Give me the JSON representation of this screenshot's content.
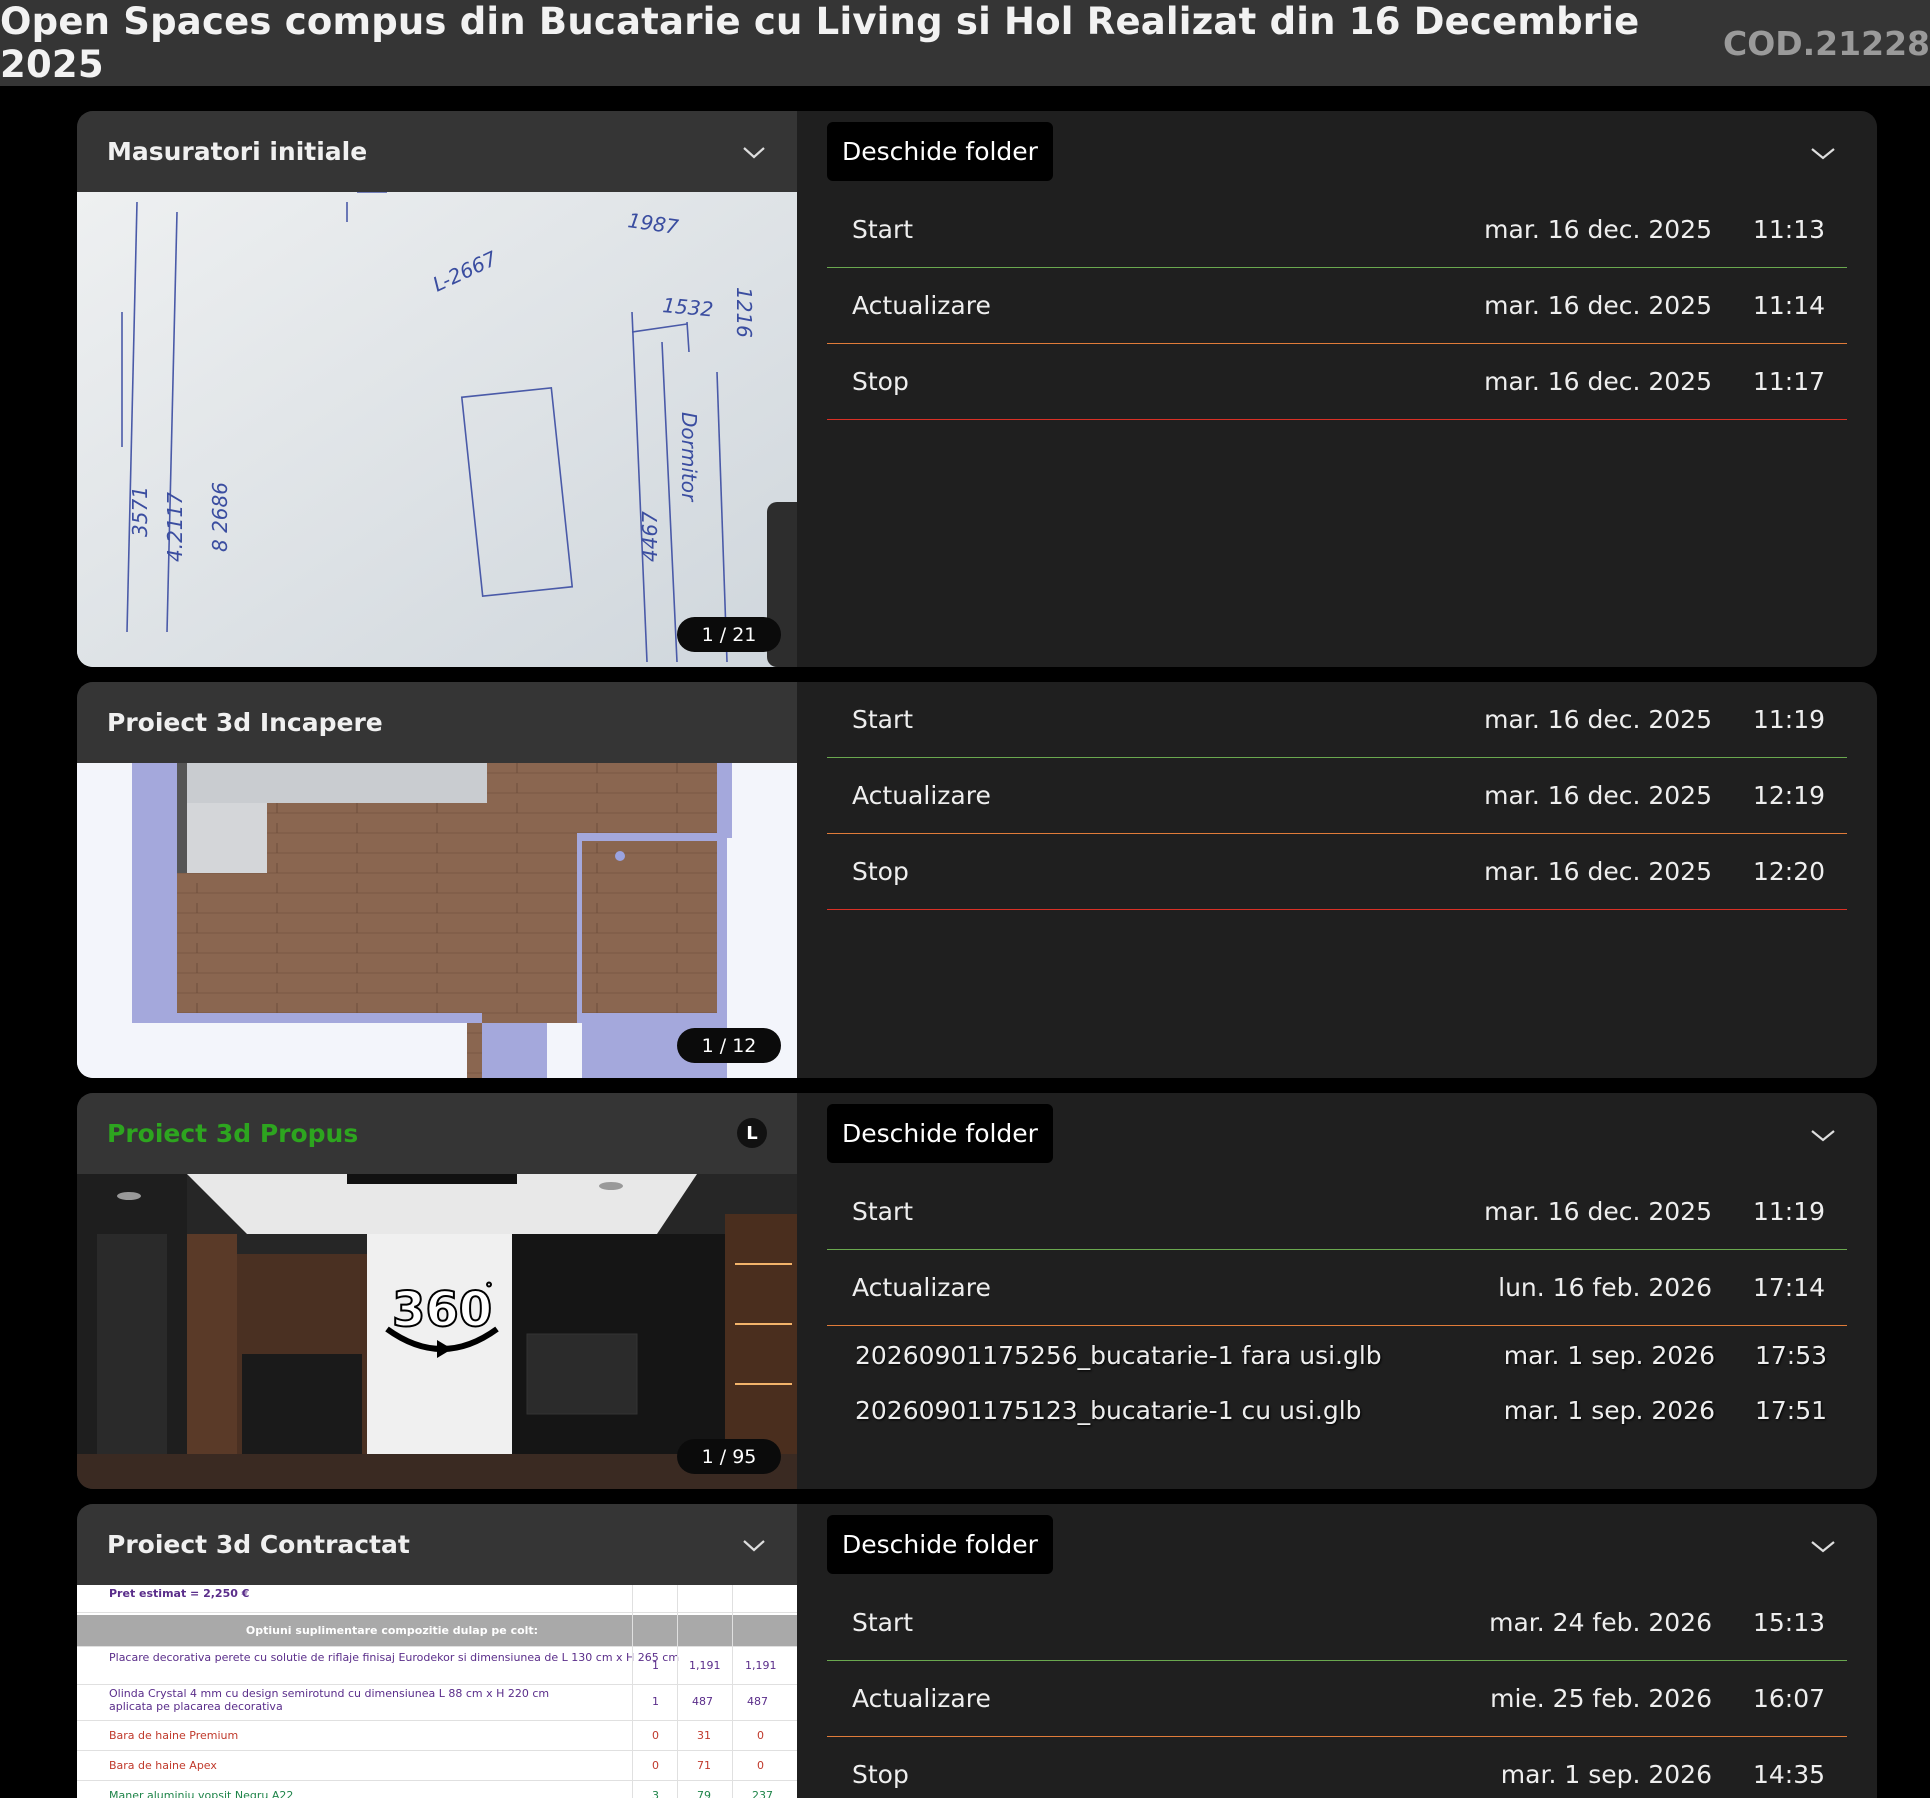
{
  "header": {
    "title": "Open Spaces compus din Bucatarie cu Living si Hol Realizat din 16 Decembrie 2025",
    "code": "COD.21228"
  },
  "sections": [
    {
      "title": "Masuratori initiale",
      "counter": "1  /  21",
      "folder_button": "Deschide folder",
      "rows": [
        {
          "label": "Start",
          "date": "mar. 16 dec. 2025",
          "time": "11:13"
        },
        {
          "label": "Actualizare",
          "date": "mar. 16 dec. 2025",
          "time": "11:14"
        },
        {
          "label": "Stop",
          "date": "mar. 16 dec. 2025",
          "time": "11:17"
        }
      ]
    },
    {
      "title": "Proiect 3d Incapere",
      "counter": "1  /  12",
      "rows": [
        {
          "label": "Start",
          "date": "mar. 16 dec. 2025",
          "time": "11:19"
        },
        {
          "label": "Actualizare",
          "date": "mar. 16 dec. 2025",
          "time": "12:19"
        },
        {
          "label": "Stop",
          "date": "mar. 16 dec. 2025",
          "time": "12:20"
        }
      ]
    },
    {
      "title": "Proiect 3d Propus",
      "badge": "L",
      "counter": "1  /  95",
      "folder_button": "Deschide folder",
      "rows": [
        {
          "label": "Start",
          "date": "mar. 16 dec. 2025",
          "time": "11:19"
        },
        {
          "label": "Actualizare",
          "date": "lun. 16 feb. 2026",
          "time": "17:14"
        }
      ],
      "files": [
        {
          "name": "20260901175256_bucatarie-1 fara usi.glb",
          "date": "mar.  1 sep. 2026",
          "time": "17:53"
        },
        {
          "name": "20260901175123_bucatarie-1 cu usi.glb",
          "date": "mar.  1 sep. 2026",
          "time": "17:51"
        }
      ]
    },
    {
      "title": "Proiect 3d Contractat",
      "folder_button": "Deschide folder",
      "rows": [
        {
          "label": "Start",
          "date": "mar. 24 feb. 2026",
          "time": "15:13"
        },
        {
          "label": "Actualizare",
          "date": "mie. 25 feb. 2026",
          "time": "16:07"
        },
        {
          "label": "Stop",
          "date": "mar.  1 sep. 2026",
          "time": "14:35"
        }
      ],
      "sheet": {
        "price": "Pret estimat = 2,250 €",
        "section_header": "Optiuni suplimentare compozitie dulap pe colt:",
        "lines": [
          {
            "text": "Placare decorativa perete cu solutie de riflaje finisaj Eurodekor si dimensiunea de L 130 cm x H 265 cm",
            "q": "1",
            "p": "1,191",
            "t": "1,191",
            "color": "#5a2d8a"
          },
          {
            "text": "Olinda Crystal 4 mm cu design semirotund cu dimensiunea L 88 cm x H 220 cm aplicata pe placarea decorativa",
            "q": "1",
            "p": "487",
            "t": "487",
            "color": "#5a2d8a"
          },
          {
            "text": "Bara de haine Premium",
            "q": "0",
            "p": "31",
            "t": "0",
            "color": "#c0392b"
          },
          {
            "text": "Bara de haine Apex",
            "q": "0",
            "p": "71",
            "t": "0",
            "color": "#c0392b"
          },
          {
            "text": "Maner aluminiu vopsit Negru A22",
            "q": "3",
            "p": "79",
            "t": "237",
            "color": "#1e8449"
          }
        ]
      }
    }
  ],
  "icons": {
    "chevron": "chevron-down-icon",
    "badge": "l-badge-icon",
    "view360": "360-view-icon"
  },
  "colors": {
    "green_line": "#6aa84f",
    "orange_line": "#e07b39",
    "red_line": "#d93025",
    "green_title": "#2da51f"
  }
}
